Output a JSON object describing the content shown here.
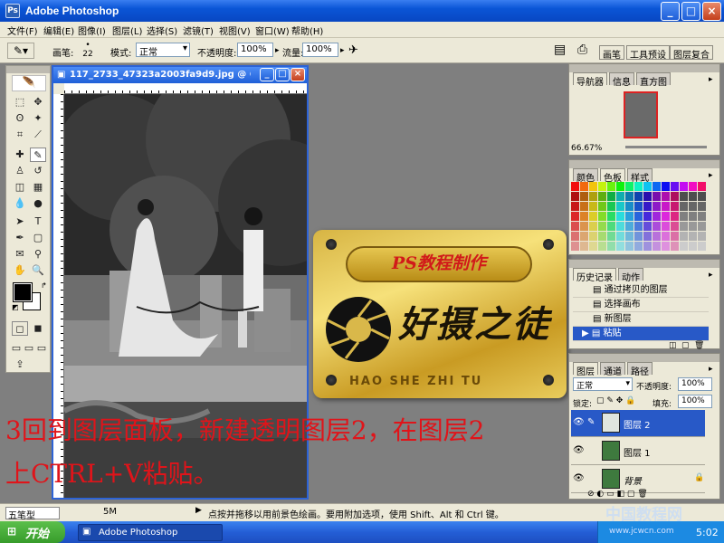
{
  "app": {
    "title": "Adobe Photoshop"
  },
  "menu": [
    "文件(F)",
    "编辑(E)",
    "图像(I)",
    "图层(L)",
    "选择(S)",
    "滤镜(T)",
    "视图(V)",
    "窗口(W)",
    "帮助(H)"
  ],
  "options": {
    "brush_label": "画笔:",
    "brush_size": "22",
    "mode_label": "模式:",
    "mode_value": "正常",
    "opacity_label": "不透明度:",
    "opacity_value": "100%",
    "flow_label": "流量:",
    "flow_value": "100%",
    "tabs": [
      "画笔",
      "工具预设",
      "图层复合"
    ]
  },
  "document": {
    "title": "117_2733_47323a2003fa9d9.jpg @ 66..."
  },
  "plaque": {
    "ps_tutorial": "PS教程制作",
    "brand_cn": "好摄之徒",
    "brand_en": "HAO SHE ZHI TU"
  },
  "annotation": {
    "line1": "3回到图层面板，新建透明图层2，在图层2",
    "line2": "上CTRL+V粘贴。"
  },
  "navigator": {
    "tabs": [
      "导航器",
      "信息",
      "直方图"
    ],
    "zoom": "66.67%"
  },
  "swatches": {
    "tabs": [
      "颜色",
      "色板",
      "样式"
    ]
  },
  "history": {
    "tabs": [
      "历史记录",
      "动作"
    ],
    "items": [
      "通过拷贝的图层",
      "选择画布",
      "新图层",
      "粘贴"
    ]
  },
  "layers": {
    "tabs": [
      "图层",
      "通道",
      "路径"
    ],
    "blend_mode": "正常",
    "opacity_label": "不透明度:",
    "opacity_value": "100%",
    "lock_label": "锁定:",
    "fill_label": "填充:",
    "fill_value": "100%",
    "items": [
      "图层 2",
      "图层 1",
      "背景"
    ]
  },
  "status": {
    "ime": "五笔型",
    "doc_size": "5M",
    "hint": "点按并拖移以用前景色绘画。要用附加选项，使用 Shift、Alt 和 Ctrl 键。"
  },
  "taskbar": {
    "start": "开始",
    "task": "Adobe Photoshop",
    "time": "5:02",
    "watermark": "中国教程网",
    "watermark_url": "www.jcwcn.com"
  },
  "colors": {
    "accent": "#2859c7",
    "annotation_red": "#e0141a",
    "plaque_gold": "#e9cc5c",
    "workspace_gray": "#7f7f7f"
  }
}
